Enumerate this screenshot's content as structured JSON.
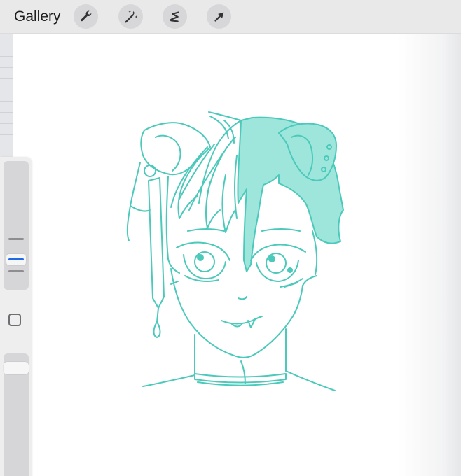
{
  "toolbar": {
    "gallery_label": "Gallery",
    "tools": [
      {
        "name": "actions",
        "icon": "wrench-icon"
      },
      {
        "name": "adjustments",
        "icon": "magic-wand-icon"
      },
      {
        "name": "selection",
        "icon": "selection-s-icon"
      },
      {
        "name": "transform",
        "icon": "arrow-cursor-icon"
      }
    ]
  },
  "canvas": {
    "line_color": "#4bc9bb",
    "fill_color": "#9ee6dc",
    "background": "#ffffff"
  },
  "sidebar": {
    "brush_size": 0.2,
    "brush_opacity": 0.9,
    "accent_color": "#1e6be6"
  }
}
